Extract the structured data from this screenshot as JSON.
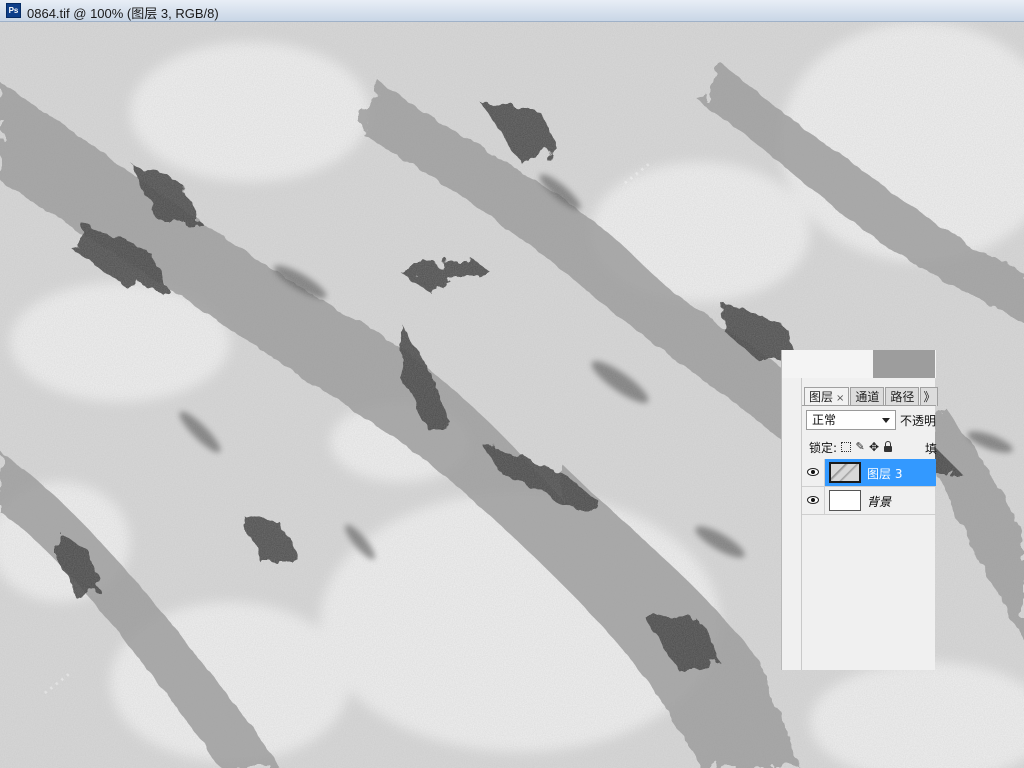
{
  "window": {
    "app_icon": "Ps",
    "title": "0864.tif @ 100% (图层 3, RGB/8)"
  },
  "layers_panel": {
    "tabs": [
      {
        "label": "图层",
        "active": true,
        "close": "×"
      },
      {
        "label": "通道",
        "active": false
      },
      {
        "label": "路径",
        "active": false
      },
      {
        "label": "》",
        "active": false
      }
    ],
    "blend_mode": "正常",
    "opacity_label": "不透明",
    "lock_label": "锁定:",
    "fill_label": "填",
    "layers": [
      {
        "name": "图层 3",
        "selected": true,
        "visible": true,
        "thumbnail": "marble"
      },
      {
        "name": "背景",
        "selected": false,
        "visible": true,
        "thumbnail": "white"
      }
    ]
  },
  "icons": {
    "app": "photoshop-icon",
    "visibility": "eye-icon",
    "lock_transparent": "lock-transparent-icon",
    "lock_image": "brush-icon",
    "lock_position": "move-icon",
    "lock_all": "padlock-icon"
  },
  "colors": {
    "selection": "#3399ff",
    "titlebar": "#c9d6e6",
    "panel": "#f0f0f0"
  }
}
